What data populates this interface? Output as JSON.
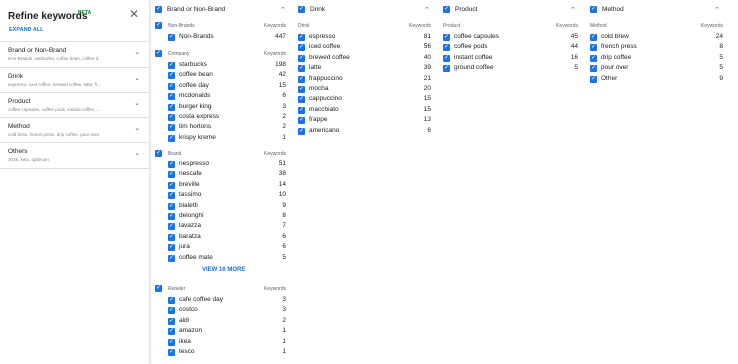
{
  "panel": {
    "title": "Refine keywords",
    "beta": "BETA",
    "close": "✕",
    "expand_all": "EXPAND ALL",
    "sections": [
      {
        "title": "Brand or Non-Brand",
        "sub": "Non-Brands, starbucks, coffee bean, coffee d..."
      },
      {
        "title": "Drink",
        "sub": "espresso, iced coffee, brewed coffee, latte, fr..."
      },
      {
        "title": "Product",
        "sub": "coffee capsules, coffee pods, instant coffee, ..."
      },
      {
        "title": "Method",
        "sub": "cold brew, french press, drip coffee, pour over"
      },
      {
        "title": "Others",
        "sub": "2019, keto, optimum"
      }
    ]
  },
  "brand": {
    "title": "Brand or Non-Brand",
    "nonbrands": {
      "label": "Non-Brands",
      "kw": "Keywords",
      "rows": [
        {
          "name": "Non-Brands",
          "n": "447"
        }
      ]
    },
    "company": {
      "label": "Company",
      "kw": "Keywords",
      "rows": [
        {
          "name": "starbucks",
          "n": "198"
        },
        {
          "name": "coffee bean",
          "n": "42"
        },
        {
          "name": "coffee day",
          "n": "15"
        },
        {
          "name": "mcdonalds",
          "n": "6"
        },
        {
          "name": "burger king",
          "n": "3"
        },
        {
          "name": "costa express",
          "n": "2"
        },
        {
          "name": "tim hortons",
          "n": "2"
        },
        {
          "name": "krispy kreme",
          "n": "1"
        }
      ]
    },
    "brand": {
      "label": "Brand",
      "kw": "Keywords",
      "rows": [
        {
          "name": "nespresso",
          "n": "51"
        },
        {
          "name": "nescafe",
          "n": "38"
        },
        {
          "name": "breville",
          "n": "14"
        },
        {
          "name": "tassimo",
          "n": "10"
        },
        {
          "name": "bialetti",
          "n": "9"
        },
        {
          "name": "delonghi",
          "n": "8"
        },
        {
          "name": "lavazza",
          "n": "7"
        },
        {
          "name": "baratza",
          "n": "6"
        },
        {
          "name": "jura",
          "n": "6"
        },
        {
          "name": "coffee mate",
          "n": "5"
        }
      ],
      "more": "VIEW 16 MORE"
    },
    "retailer": {
      "label": "Retailer",
      "kw": "Keywords",
      "rows": [
        {
          "name": "cafe coffee day",
          "n": "3"
        },
        {
          "name": "costco",
          "n": "3"
        },
        {
          "name": "aldi",
          "n": "2"
        },
        {
          "name": "amazon",
          "n": "1"
        },
        {
          "name": "ikea",
          "n": "1"
        },
        {
          "name": "tesco",
          "n": "1"
        }
      ]
    }
  },
  "drink": {
    "title": "Drink",
    "label": "Drink",
    "kw": "Keywords",
    "rows": [
      {
        "name": "espresso",
        "n": "81"
      },
      {
        "name": "iced coffee",
        "n": "56"
      },
      {
        "name": "brewed coffee",
        "n": "40"
      },
      {
        "name": "latte",
        "n": "39"
      },
      {
        "name": "frappuccino",
        "n": "21"
      },
      {
        "name": "mocha",
        "n": "20"
      },
      {
        "name": "cappuccino",
        "n": "15"
      },
      {
        "name": "macchiato",
        "n": "15"
      },
      {
        "name": "frappe",
        "n": "13"
      },
      {
        "name": "americano",
        "n": "6"
      }
    ]
  },
  "product": {
    "title": "Product",
    "label": "Product",
    "kw": "Keywords",
    "rows": [
      {
        "name": "coffee capsules",
        "n": "45"
      },
      {
        "name": "coffee pods",
        "n": "44"
      },
      {
        "name": "instant coffee",
        "n": "16"
      },
      {
        "name": "ground coffee",
        "n": "5"
      }
    ]
  },
  "method": {
    "title": "Method",
    "label": "Method",
    "kw": "Keywords",
    "rows": [
      {
        "name": "cold brew",
        "n": "24"
      },
      {
        "name": "french press",
        "n": "8"
      },
      {
        "name": "drip coffee",
        "n": "5"
      },
      {
        "name": "pour over",
        "n": "5"
      },
      {
        "name": "Other",
        "n": "9"
      }
    ]
  },
  "icons": {
    "check": "check-icon",
    "chevron_up": "chevron-up-icon",
    "chevron_down": "chevron-down-icon",
    "close": "close-icon"
  },
  "colors": {
    "accent": "#1a73e8",
    "beta": "#188038"
  }
}
